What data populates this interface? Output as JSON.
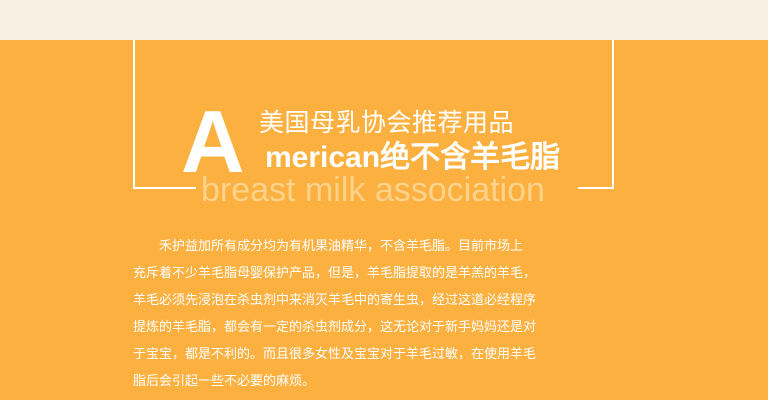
{
  "colors": {
    "background": "#fbb040",
    "top_band": "#f8efe3",
    "text": "#ffffff",
    "subtitle": "#fdd38c"
  },
  "header": {
    "big_letter": "A",
    "headline_line1": "美国母乳协会推荐用品",
    "headline_line2": "merican绝不含羊毛脂",
    "subtitle": "breast milk association"
  },
  "body": {
    "lines": [
      "禾护益加所有成分均为有机果油精华，不含羊毛脂。目前市场上",
      "充斥着不少羊毛脂母婴保护产品，但是，羊毛脂提取的是羊羔的羊毛，",
      "羊毛必须先浸泡在杀虫剂中来消灭羊毛中的寄生虫，经过这道必经程序",
      "提炼的羊毛脂，都会有一定的杀虫剂成分，这无论对于新手妈妈还是对",
      "于宝宝，都是不利的。而且很多女性及宝宝对于羊毛过敏，在使用羊毛",
      "脂后会引起一些不必要的麻烦。"
    ]
  }
}
